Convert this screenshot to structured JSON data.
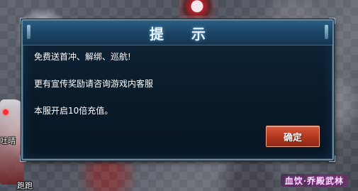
{
  "dialog": {
    "title": "提 示",
    "lines": [
      "免费送首冲、解绑、巡航!",
      "更有宣传奖励请咨询游戏内客服",
      "本服开启10倍充值。"
    ],
    "confirm_label": "确定"
  },
  "background": {
    "name_tags": [
      "吐晴",
      "跑跑"
    ],
    "brand_text": "血饮·乔殿武林"
  }
}
